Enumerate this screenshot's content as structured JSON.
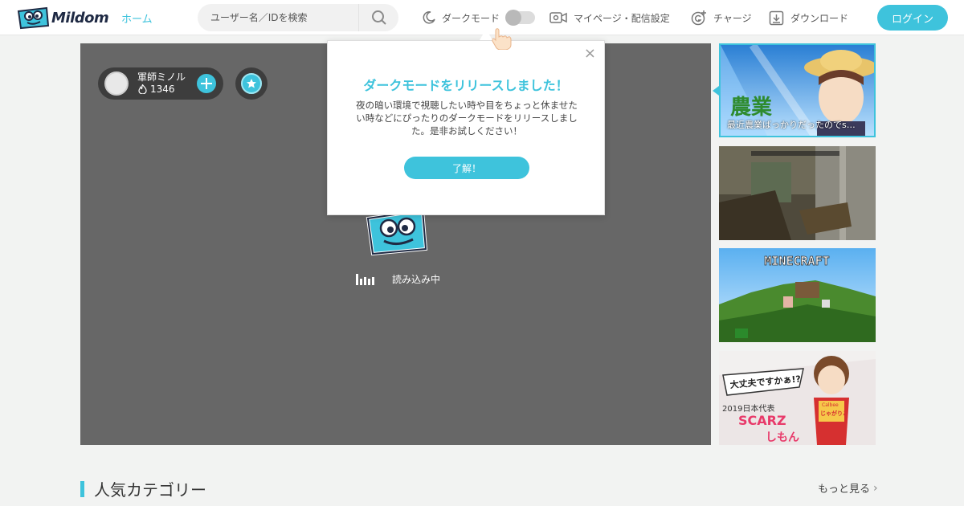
{
  "header": {
    "logo_text": "Mildom",
    "nav_home": "ホーム",
    "search_placeholder": "ユーザー名／IDを検索",
    "dark_mode_label": "ダークモード",
    "mypage_label": "マイページ・配信設定",
    "charge_label": "チャージ",
    "download_label": "ダウンロード",
    "login_label": "ログイン"
  },
  "player": {
    "streamer_name": "軍師ミノル",
    "fans_count": "1346",
    "loading_text": "読み込み中"
  },
  "popup": {
    "title": "ダークモードをリリースしました！",
    "body": "夜の暗い環境で視聴したい時や目をちょっと休ませたい時などにぴったりのダークモードをリリースしました。是非お試しください！",
    "button": "了解！",
    "close": "×"
  },
  "sidebar": {
    "items": [
      {
        "caption": "最近農業ばっかりだったのでs…",
        "art": "農業"
      },
      {
        "caption": ""
      },
      {
        "caption": "",
        "art": "MINECRAFT"
      },
      {
        "caption": "",
        "art1": "大丈夫ですかぁ!?",
        "art2": "2019日本代表",
        "art3": "SCARZ",
        "art4": "しもん",
        "art5": "じゃがりこ",
        "art6": "Calbee"
      }
    ]
  },
  "section": {
    "title": "人気カテゴリー",
    "see_more": "もっと見る"
  },
  "colors": {
    "accent": "#3ec3dc",
    "player_bg": "#676767"
  }
}
